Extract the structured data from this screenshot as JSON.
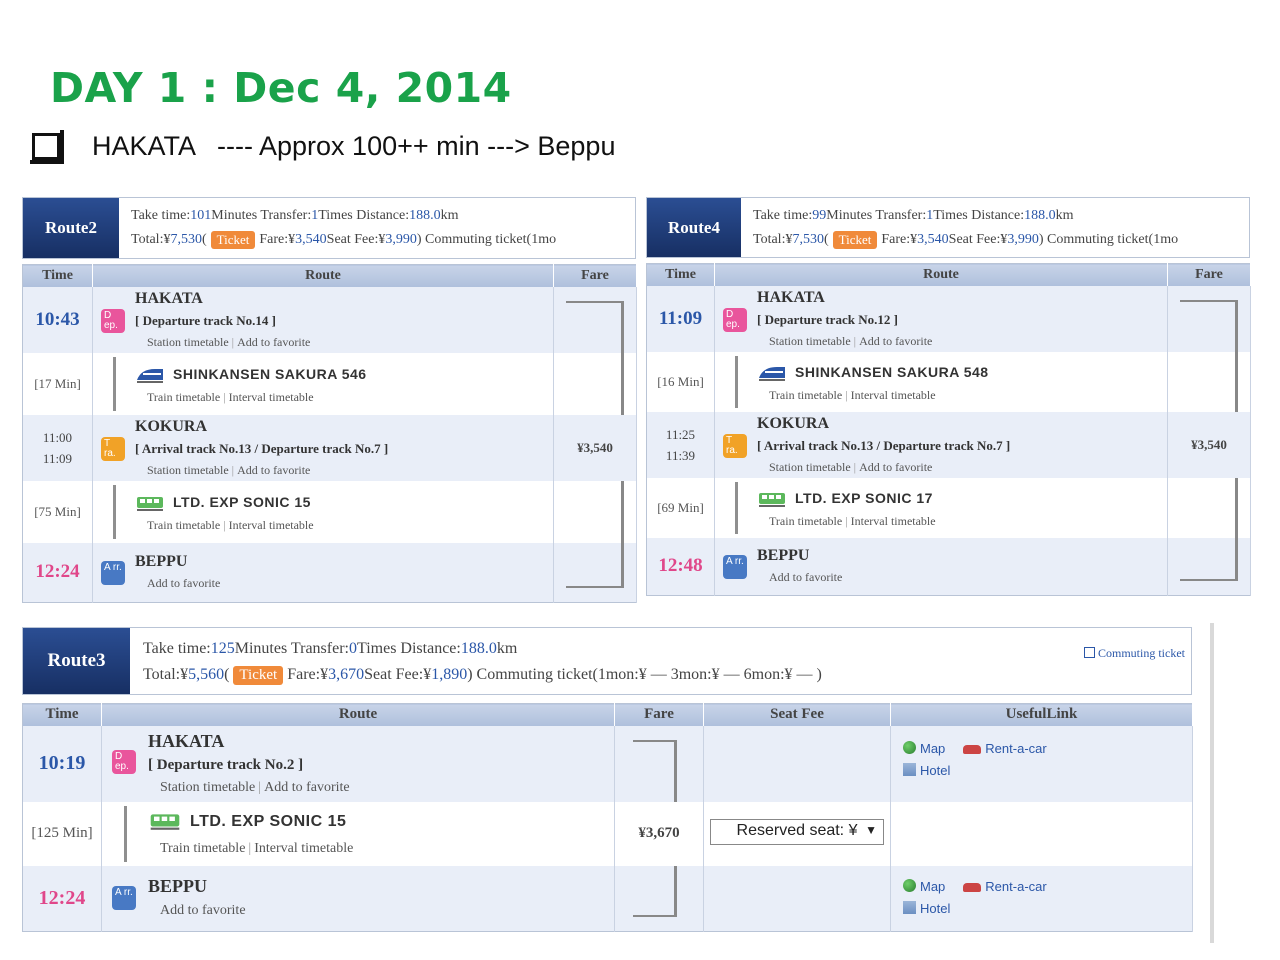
{
  "header": {
    "title": "DAY 1 : Dec 4, 2014",
    "subtitle": "HAKATA   ---- Approx 100++ min ---> Beppu"
  },
  "labels": {
    "time": "Time",
    "route": "Route",
    "fare": "Fare",
    "seat_fee": "Seat Fee",
    "useful_link": "UsefulLink",
    "ticket": "Ticket",
    "station_timetable": "Station timetable",
    "add_to_favorite": "Add to favorite",
    "train_timetable": "Train timetable",
    "interval_timetable": "Interval timetable",
    "map": "Map",
    "rent_a_car": "Rent-a-car",
    "hotel": "Hotel",
    "commuting_ticket": "Commuting ticket",
    "badge_dep": "D ep.",
    "badge_tra": "T ra.",
    "badge_arr": "A rr."
  },
  "route2": {
    "label": "Route2",
    "line1": {
      "t1": "Take time: ",
      "v1": "101",
      "t2": " Minutes  Transfer: ",
      "v2": "1",
      "t3": " Times  Distance: ",
      "v3": "188.0",
      "t4": " km"
    },
    "line2": {
      "t1": "Total:¥ ",
      "v1": "7,530",
      "t2": "(",
      "t3": " Fare:¥ ",
      "v3": "3,540",
      "t4": "  Seat Fee:¥ ",
      "v4": "3,990",
      "t5": ")  Commuting ticket(1mo"
    },
    "rows": {
      "dep_time": "10:43",
      "dep_station": "HAKATA",
      "dep_track": "[ Departure track No.14 ]",
      "dur1": "[17 Min]",
      "train1": "SHINKANSEN SAKURA 546",
      "tra_time1": "11:00",
      "tra_time2": "11:09",
      "tra_station": "KOKURA",
      "tra_track": "[ Arrival track No.13 / Departure track No.7 ]",
      "fare": "¥3,540",
      "dur2": "[75 Min]",
      "train2": "LTD. EXP SONIC 15",
      "arr_time": "12:24",
      "arr_station": "BEPPU"
    }
  },
  "route4": {
    "label": "Route4",
    "line1": {
      "t1": "Take time: ",
      "v1": "99",
      "t2": " Minutes  Transfer: ",
      "v2": "1",
      "t3": " Times  Distance: ",
      "v3": "188.0",
      "t4": " km"
    },
    "line2": {
      "t1": "Total:¥ ",
      "v1": "7,530",
      "t2": "(",
      "t3": " Fare:¥ ",
      "v3": "3,540",
      "t4": "  Seat Fee:¥ ",
      "v4": "3,990",
      "t5": ")  Commuting ticket(1mo"
    },
    "rows": {
      "dep_time": "11:09",
      "dep_station": "HAKATA",
      "dep_track": "[ Departure track No.12 ]",
      "dur1": "[16 Min]",
      "train1": "SHINKANSEN SAKURA 548",
      "tra_time1": "11:25",
      "tra_time2": "11:39",
      "tra_station": "KOKURA",
      "tra_track": "[ Arrival track No.13 / Departure track No.7 ]",
      "fare": "¥3,540",
      "dur2": "[69 Min]",
      "train2": "LTD. EXP SONIC 17",
      "arr_time": "12:48",
      "arr_station": "BEPPU"
    }
  },
  "route3": {
    "label": "Route3",
    "line1": {
      "t1": "Take time: ",
      "v1": "125",
      "t2": " Minutes  Transfer: ",
      "v2": "0",
      "t3": " Times  Distance: ",
      "v3": "188.0",
      "t4": " km"
    },
    "line2": {
      "t1": "Total:¥ ",
      "v1": "5,560",
      "t2": "(",
      "t3": " Fare:¥ ",
      "v3": "3,670",
      "t4": "  Seat Fee:¥ ",
      "v4": "1,890",
      "t5": ")  Commuting ticket(1mon:¥ —   3mon:¥ —   6mon:¥ — )"
    },
    "rows": {
      "dep_time": "10:19",
      "dep_station": "HAKATA",
      "dep_track": "[ Departure track No.2 ]",
      "dur1": "[125 Min]",
      "train1": "LTD. EXP SONIC 15",
      "fare": "¥3,670",
      "seat_select_value": "Reserved seat: ¥",
      "arr_time": "12:24",
      "arr_station": "BEPPU"
    }
  }
}
